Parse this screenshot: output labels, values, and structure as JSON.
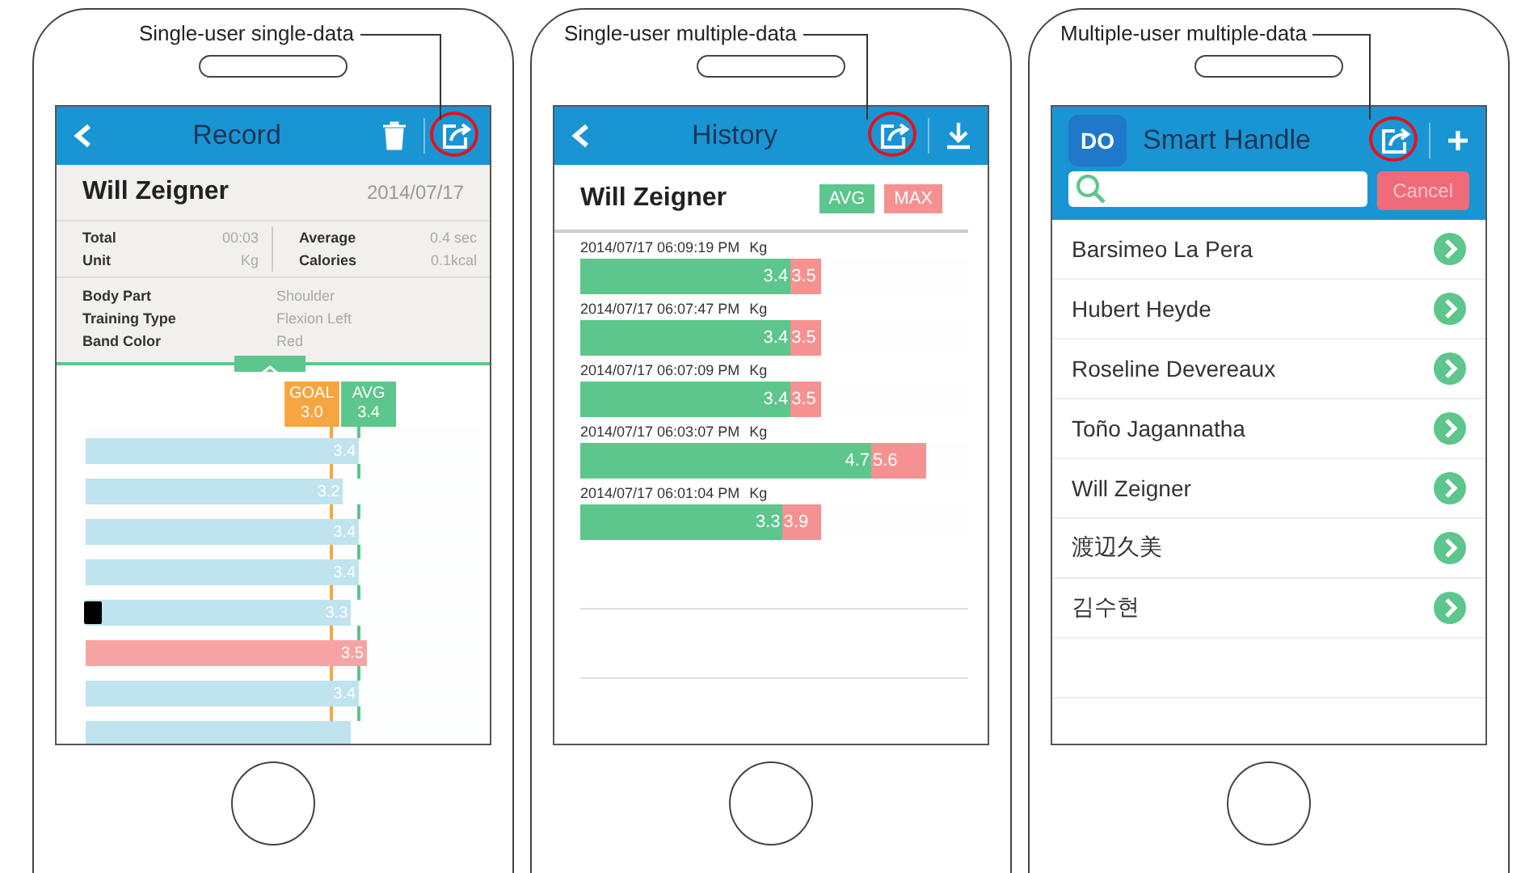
{
  "phones": [
    {
      "kind": "record",
      "caption": "Single-user single-data",
      "header": {
        "title": "Record",
        "actions": [
          {
            "kind": "trash",
            "circled": false
          },
          {
            "kind": "share",
            "circled": true
          }
        ]
      },
      "name": "Will Zeigner",
      "date": "2014/07/17",
      "stats": [
        {
          "label": "Total",
          "value": "00:03"
        },
        {
          "label": "Average",
          "value": "0.4 sec"
        },
        {
          "label": "Unit",
          "value": "Kg"
        },
        {
          "label": "Calories",
          "value": "0.1kcal"
        }
      ],
      "details": [
        {
          "label": "Body Part",
          "value": "Shoulder"
        },
        {
          "label": "Training Type",
          "value": "Flexion Left"
        },
        {
          "label": "Band Color",
          "value": "Red"
        }
      ],
      "markers": [
        {
          "label": "GOAL",
          "value": "3.0",
          "level": 0.62,
          "color": "#f7a541"
        },
        {
          "label": "AVG",
          "value": "3.4",
          "level": 0.69,
          "color": "#5cc68c"
        }
      ],
      "bars": [
        {
          "kind": "plain",
          "value": "3.4",
          "level": 0.69,
          "highlighted": false
        },
        {
          "kind": "plain",
          "value": "3.2",
          "level": 0.65,
          "highlighted": false
        },
        {
          "kind": "plain",
          "value": "3.4",
          "level": 0.69,
          "highlighted": false
        },
        {
          "kind": "plain",
          "value": "3.4",
          "level": 0.69,
          "highlighted": false
        },
        {
          "kind": "noted",
          "value": "3.3",
          "level": 0.67,
          "highlighted": false
        },
        {
          "kind": "plain",
          "value": "3.5",
          "level": 0.71,
          "highlighted": true
        },
        {
          "kind": "plain",
          "value": "3.4",
          "level": 0.69,
          "highlighted": false
        },
        {
          "kind": "plain",
          "level": 0.67,
          "highlighted": false
        }
      ]
    },
    {
      "kind": "history",
      "caption": "Single-user multiple-data",
      "header": {
        "title": "History",
        "actions": [
          {
            "kind": "share",
            "circled": true
          },
          {
            "kind": "download",
            "circled": false
          }
        ]
      },
      "name": "Will Zeigner",
      "legend": [
        {
          "label": "AVG",
          "color": "#5cc68c"
        },
        {
          "label": "MAX",
          "color": "#f59191"
        }
      ],
      "rows": [
        {
          "time": "2014/07/17 06:09:19 PM",
          "unit": "Kg",
          "avg": {
            "value": "3.4",
            "level": 0.54
          },
          "max": {
            "value": "3.5",
            "level": 0.62
          }
        },
        {
          "time": "2014/07/17 06:07:47 PM",
          "unit": "Kg",
          "avg": {
            "value": "3.4",
            "level": 0.54
          },
          "max": {
            "value": "3.5",
            "level": 0.62
          }
        },
        {
          "time": "2014/07/17 06:07:09 PM",
          "unit": "Kg",
          "avg": {
            "value": "3.4",
            "level": 0.54
          },
          "max": {
            "value": "3.5",
            "level": 0.62
          }
        },
        {
          "time": "2014/07/17 06:03:07 PM",
          "unit": "Kg",
          "avg": {
            "value": "4.7",
            "level": 0.75
          },
          "max": {
            "value": "5.6",
            "level": 0.89
          }
        },
        {
          "time": "2014/07/17 06:01:04 PM",
          "unit": "Kg",
          "avg": {
            "value": "3.3",
            "level": 0.52
          },
          "max": {
            "value": "3.9",
            "level": 0.62
          }
        }
      ]
    },
    {
      "kind": "list",
      "caption": "Multiple-user multiple-data",
      "header": {
        "title": "Smart Handle",
        "logo": "DO",
        "actions": [
          {
            "kind": "share",
            "circled": true
          },
          {
            "kind": "plus",
            "circled": false
          }
        ]
      },
      "search": {
        "cancel": "Cancel"
      },
      "users": [
        "Barsimeo La Pera",
        "Hubert Heyde",
        "Roseline Devereaux",
        "Toño Jagannatha",
        "Will Zeigner",
        "渡辺久美",
        "김수현"
      ]
    }
  ]
}
